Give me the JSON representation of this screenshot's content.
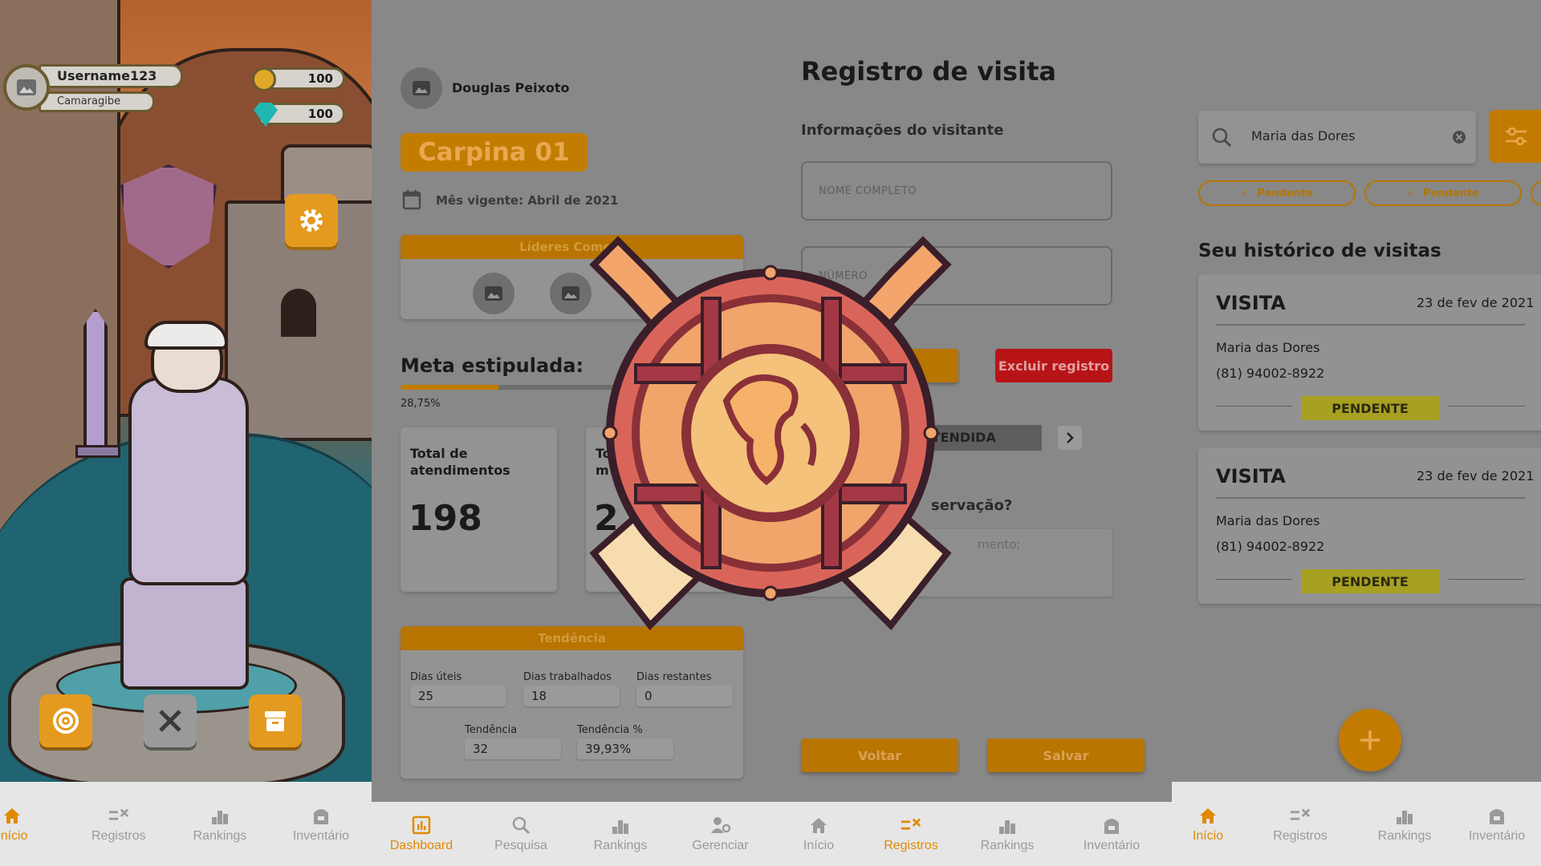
{
  "game": {
    "username": "Username123",
    "city": "Camaragibe",
    "coins": "100",
    "gems": "100",
    "nav": [
      {
        "label": "Início",
        "icon": "home-icon",
        "active": true
      },
      {
        "label": "Registros",
        "icon": "registros-icon",
        "active": false
      },
      {
        "label": "Rankings",
        "icon": "rankings-icon",
        "active": false
      },
      {
        "label": "Inventário",
        "icon": "inventory-icon",
        "active": false
      }
    ]
  },
  "dashboard": {
    "user_name": "Douglas Peixoto",
    "store": "Carpina 01",
    "month": "Mês vigente: Abril de 2021",
    "leaders_title": "Líderes Comerc",
    "goal_title": "Meta estipulada:",
    "goal_percent": "28,75%",
    "goal_fraction": 0.2875,
    "total_label": "Total de atendimentos",
    "total_value": "198",
    "second_label": "To m",
    "second_value": "2",
    "trend_title": "Tendência",
    "dias_uteis_label": "Dias úteis",
    "dias_uteis": "25",
    "dias_trab_label": "Dias trabalhados",
    "dias_trab": "18",
    "dias_rest_label": "Dias restantes",
    "dias_rest": "0",
    "tendencia_label": "Tendência",
    "tendencia": "32",
    "tendencia_pct_label": "Tendência %",
    "tendencia_pct": "39,93%",
    "nav": [
      {
        "label": "Dashboard",
        "icon": "dashboard-icon",
        "active": true
      },
      {
        "label": "Pesquisa",
        "icon": "search-icon",
        "active": false
      },
      {
        "label": "Rankings",
        "icon": "rankings-icon",
        "active": false
      },
      {
        "label": "Gerenciar",
        "icon": "manage-icon",
        "active": false
      }
    ]
  },
  "form": {
    "title": "Registro de visita",
    "section": "Informações do visitante",
    "name_placeholder": "NOME COMPLETO",
    "number_placeholder": "NÚMERO",
    "delete_label": "Excluir registro",
    "status_text": "ÃO ATENDIDA",
    "obs_label": "servação?",
    "obs_placeholder": "mento;",
    "back_label": "Voltar",
    "save_label": "Salvar",
    "nav": [
      {
        "label": "Início",
        "icon": "home-icon",
        "active": false
      },
      {
        "label": "Registros",
        "icon": "registros-icon",
        "active": true
      },
      {
        "label": "Rankings",
        "icon": "rankings-icon",
        "active": false
      },
      {
        "label": "Inventário",
        "icon": "inventory-icon",
        "active": false
      }
    ]
  },
  "list": {
    "search_value": "Maria das Dores",
    "chips": [
      "Pendente",
      "Pendente"
    ],
    "history_title": "Seu histórico de visitas",
    "visits": [
      {
        "title": "VISITA",
        "date": "23 de fev de 2021",
        "name": "Maria das Dores",
        "phone": "(81) 94002-8922",
        "status": "PENDENTE"
      },
      {
        "title": "VISITA",
        "date": "23 de fev de 2021",
        "name": "Maria das Dores",
        "phone": "(81) 94002-8922",
        "status": "PENDENTE"
      }
    ],
    "nav": [
      {
        "label": "Início",
        "icon": "home-icon",
        "active": true
      },
      {
        "label": "Registros",
        "icon": "registros-icon",
        "active": false
      },
      {
        "label": "Rankings",
        "icon": "rankings-icon",
        "active": false
      },
      {
        "label": "Inventário",
        "icon": "inventory-icon",
        "active": false
      }
    ]
  },
  "colors": {
    "accent": "#e08a00",
    "danger": "#b81418",
    "pending": "#a8a021"
  }
}
